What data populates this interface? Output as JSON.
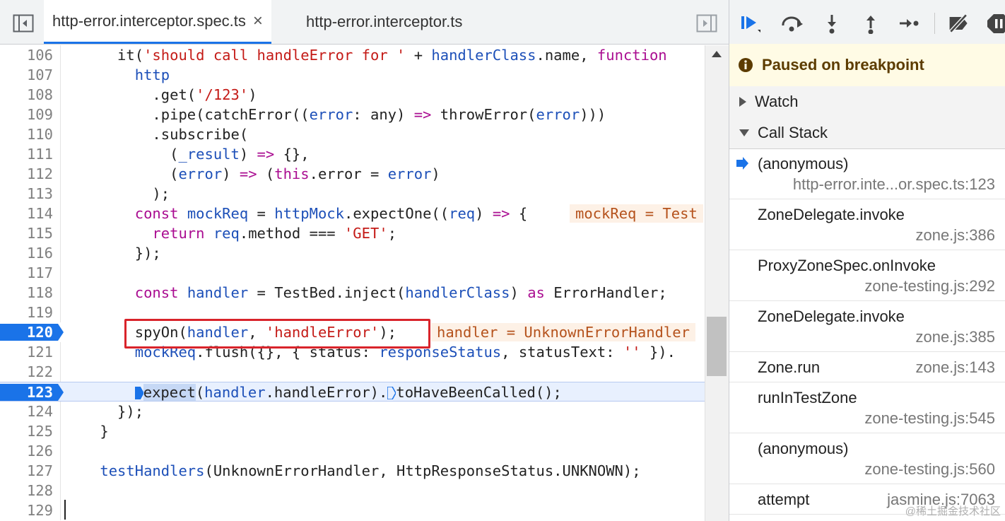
{
  "tabs": [
    {
      "label": "http-error.interceptor.spec.ts",
      "close": "×",
      "active": true
    },
    {
      "label": "http-error.interceptor.ts",
      "active": false
    }
  ],
  "icons": {
    "toggle_navigator": "sidebar-toggle-icon",
    "toggle_debugger": "debugger-panel-toggle-icon",
    "resume": "resume-icon",
    "step_over": "step-over-icon",
    "step_into": "step-into-icon",
    "step_out": "step-out-icon",
    "step": "step-icon",
    "deactivate": "deactivate-breakpoints-icon",
    "pause_exceptions": "pause-on-exceptions-icon"
  },
  "colors": {
    "breakpoint": "#1a73e8",
    "keyword": "#aa0d91",
    "string": "#c41a16",
    "variable": "#1c4fb8",
    "highlight_box": "#d9242b"
  },
  "code_lines": [
    {
      "num": "106",
      "tokens": [
        {
          "t": "      it(",
          "c": "p"
        },
        {
          "t": "'should call handleError for '",
          "c": "s"
        },
        {
          "t": " + ",
          "c": "p"
        },
        {
          "t": "handlerClass",
          "c": "v"
        },
        {
          "t": ".name, ",
          "c": "p"
        },
        {
          "t": "function",
          "c": "k"
        }
      ]
    },
    {
      "num": "107",
      "tokens": [
        {
          "t": "        ",
          "c": "p"
        },
        {
          "t": "http",
          "c": "v"
        }
      ]
    },
    {
      "num": "108",
      "tokens": [
        {
          "t": "          .get(",
          "c": "p"
        },
        {
          "t": "'/123'",
          "c": "s"
        },
        {
          "t": ")",
          "c": "p"
        }
      ]
    },
    {
      "num": "109",
      "tokens": [
        {
          "t": "          .pipe(catchError((",
          "c": "p"
        },
        {
          "t": "error",
          "c": "v"
        },
        {
          "t": ": any) ",
          "c": "p"
        },
        {
          "t": "=>",
          "c": "k"
        },
        {
          "t": " throwError(",
          "c": "p"
        },
        {
          "t": "error",
          "c": "v"
        },
        {
          "t": ")))",
          "c": "p"
        }
      ]
    },
    {
      "num": "110",
      "tokens": [
        {
          "t": "          .subscribe(",
          "c": "p"
        }
      ]
    },
    {
      "num": "111",
      "tokens": [
        {
          "t": "            (",
          "c": "p"
        },
        {
          "t": "_result",
          "c": "v"
        },
        {
          "t": ") ",
          "c": "p"
        },
        {
          "t": "=>",
          "c": "k"
        },
        {
          "t": " {},",
          "c": "p"
        }
      ]
    },
    {
      "num": "112",
      "tokens": [
        {
          "t": "            (",
          "c": "p"
        },
        {
          "t": "error",
          "c": "v"
        },
        {
          "t": ") ",
          "c": "p"
        },
        {
          "t": "=>",
          "c": "k"
        },
        {
          "t": " (",
          "c": "p"
        },
        {
          "t": "this",
          "c": "k"
        },
        {
          "t": ".error = ",
          "c": "p"
        },
        {
          "t": "error",
          "c": "v"
        },
        {
          "t": ")",
          "c": "p"
        }
      ]
    },
    {
      "num": "113",
      "tokens": [
        {
          "t": "          );",
          "c": "p"
        }
      ]
    },
    {
      "num": "114",
      "tokens": [
        {
          "t": "        ",
          "c": "p"
        },
        {
          "t": "const",
          "c": "k"
        },
        {
          "t": " ",
          "c": "p"
        },
        {
          "t": "mockReq",
          "c": "v"
        },
        {
          "t": " = ",
          "c": "p"
        },
        {
          "t": "httpMock",
          "c": "v"
        },
        {
          "t": ".expectOne((",
          "c": "p"
        },
        {
          "t": "req",
          "c": "v"
        },
        {
          "t": ") ",
          "c": "p"
        },
        {
          "t": "=>",
          "c": "k"
        },
        {
          "t": " {",
          "c": "p"
        }
      ],
      "inline": "mockReq = Test"
    },
    {
      "num": "115",
      "tokens": [
        {
          "t": "          ",
          "c": "p"
        },
        {
          "t": "return",
          "c": "k"
        },
        {
          "t": " ",
          "c": "p"
        },
        {
          "t": "req",
          "c": "v"
        },
        {
          "t": ".method === ",
          "c": "p"
        },
        {
          "t": "'GET'",
          "c": "s"
        },
        {
          "t": ";",
          "c": "p"
        }
      ]
    },
    {
      "num": "116",
      "tokens": [
        {
          "t": "        });",
          "c": "p"
        }
      ]
    },
    {
      "num": "117",
      "tokens": []
    },
    {
      "num": "118",
      "tokens": [
        {
          "t": "        ",
          "c": "p"
        },
        {
          "t": "const",
          "c": "k"
        },
        {
          "t": " ",
          "c": "p"
        },
        {
          "t": "handler",
          "c": "v"
        },
        {
          "t": " = TestBed.inject(",
          "c": "p"
        },
        {
          "t": "handlerClass",
          "c": "v"
        },
        {
          "t": ") ",
          "c": "p"
        },
        {
          "t": "as",
          "c": "k"
        },
        {
          "t": " ErrorHandler;",
          "c": "p"
        }
      ]
    },
    {
      "num": "119",
      "tokens": []
    },
    {
      "num": "120",
      "bp": true,
      "tokens": [
        {
          "t": "        spyOn(",
          "c": "p"
        },
        {
          "t": "handler",
          "c": "v"
        },
        {
          "t": ", ",
          "c": "p"
        },
        {
          "t": "'handleError'",
          "c": "s"
        },
        {
          "t": ");",
          "c": "p"
        }
      ],
      "inline": "handler = UnknownErrorHandler"
    },
    {
      "num": "121",
      "tokens": [
        {
          "t": "        ",
          "c": "p"
        },
        {
          "t": "mockReq",
          "c": "v"
        },
        {
          "t": ".flush({}, { status: ",
          "c": "p"
        },
        {
          "t": "responseStatus",
          "c": "v"
        },
        {
          "t": ", statusText: ",
          "c": "p"
        },
        {
          "t": "''",
          "c": "s"
        },
        {
          "t": " }).",
          "c": "p"
        }
      ]
    },
    {
      "num": "122",
      "tokens": []
    },
    {
      "num": "123",
      "bp": true,
      "exec": true,
      "tokens": [
        {
          "t": "expect",
          "c": "p"
        },
        {
          "t": "(",
          "c": "p"
        },
        {
          "t": "handler",
          "c": "v"
        },
        {
          "t": ".handleError).",
          "c": "p"
        },
        {
          "t": "toHaveBeenCalled();",
          "c": "p"
        }
      ]
    },
    {
      "num": "124",
      "tokens": [
        {
          "t": "      });",
          "c": "p"
        }
      ]
    },
    {
      "num": "125",
      "tokens": [
        {
          "t": "    }",
          "c": "p"
        }
      ]
    },
    {
      "num": "126",
      "tokens": []
    },
    {
      "num": "127",
      "tokens": [
        {
          "t": "    ",
          "c": "p"
        },
        {
          "t": "testHandlers",
          "c": "v"
        },
        {
          "t": "(UnknownErrorHandler, HttpResponseStatus.UNKNOWN);",
          "c": "p"
        }
      ]
    },
    {
      "num": "128",
      "tokens": []
    },
    {
      "num": "129",
      "tokens": []
    }
  ],
  "debugger": {
    "paused_text": "Paused on breakpoint",
    "watch_label": "Watch",
    "callstack_label": "Call Stack",
    "frames": [
      {
        "name": "(anonymous)",
        "location": "http-error.inte...or.spec.ts:123",
        "current": true,
        "two_line": true
      },
      {
        "name": "ZoneDelegate.invoke",
        "location": "zone.js:386",
        "two_line": true
      },
      {
        "name": "ProxyZoneSpec.onInvoke",
        "location": "zone-testing.js:292",
        "two_line": true
      },
      {
        "name": "ZoneDelegate.invoke",
        "location": "zone.js:385",
        "two_line": true
      },
      {
        "name": "Zone.run",
        "location": "zone.js:143",
        "two_line": false
      },
      {
        "name": "runInTestZone",
        "location": "zone-testing.js:545",
        "two_line": true
      },
      {
        "name": "(anonymous)",
        "location": "zone-testing.js:560",
        "two_line": true
      },
      {
        "name": "attempt",
        "location": "jasmine.js:7063",
        "two_line": false
      }
    ]
  },
  "watermark": "@稀土掘金技术社区"
}
